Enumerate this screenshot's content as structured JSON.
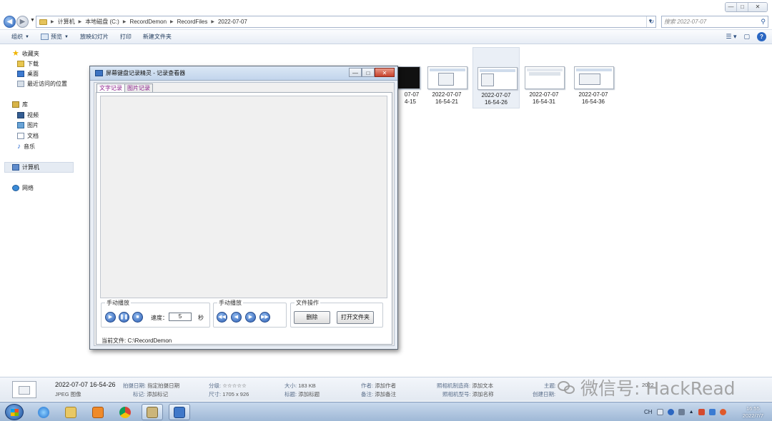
{
  "window": {
    "min": "—",
    "max": "□",
    "close": "✕"
  },
  "address": {
    "crumbs": [
      "计算机",
      "本地磁盘 (C:)",
      "RecordDemon",
      "RecordFiles",
      "2022-07-07"
    ],
    "search_placeholder": "搜索 2022-07-07"
  },
  "toolbar": {
    "organize": "组织",
    "preview": "预览",
    "slideshow": "放映幻灯片",
    "print": "打印",
    "new_folder": "新建文件夹"
  },
  "nav": {
    "favorites": "收藏夹",
    "downloads": "下载",
    "desktop": "桌面",
    "recent": "最近访问的位置",
    "libraries": "库",
    "videos": "视频",
    "pictures": "图片",
    "documents": "文档",
    "music": "音乐",
    "computer": "计算机",
    "network": "网络"
  },
  "thumbnails": [
    {
      "date": "07-07",
      "time": "4-15"
    },
    {
      "date": "2022-07-07",
      "time": "16-54-21"
    },
    {
      "date": "2022-07-07",
      "time": "16-54-26"
    },
    {
      "date": "2022-07-07",
      "time": "16-54-31"
    },
    {
      "date": "2022-07-07",
      "time": "16-54-36"
    }
  ],
  "app": {
    "title": "屏幕键盘记录精灵 - 记录查看器",
    "tab_text": "文字记录",
    "tab_image": "图片记录",
    "group_manual": "手动播放",
    "speed_label": "速度：",
    "speed_value": "5",
    "speed_unit": "秒",
    "group_manual2": "手动播放",
    "group_file": "文件操作",
    "delete_btn": "删除",
    "open_folder_btn": "打开文件夹",
    "current_file": "当前文件:   C:\\RecordDemon"
  },
  "details": {
    "name": "2022-07-07 16-54-26",
    "type": "JPEG 图像",
    "date_taken_label": "拍摄日期:",
    "date_taken": "指定拍摄日期",
    "tags_label": "标记:",
    "tags": "添加标记",
    "rating_label": "分级:",
    "rating": "☆☆☆☆☆",
    "dims_label": "尺寸:",
    "dims": "1705 x 926",
    "size_label": "大小:",
    "size": "183 KB",
    "title_label": "标题:",
    "title": "添加标题",
    "author_label": "作者:",
    "author": "添加作者",
    "comment_label": "备注:",
    "comment": "添加备注",
    "maker_label": "照相机制造商:",
    "maker": "添加文本",
    "model_label": "照相机型号:",
    "model": "添加名称",
    "subject_label": "主题:",
    "created_label": "创建日期:",
    "created": "2022"
  },
  "watermark": "微信号: HackRead",
  "clock": {
    "time": "16:55",
    "date": "2022/7/7"
  },
  "tray": {
    "lang": "CH"
  }
}
